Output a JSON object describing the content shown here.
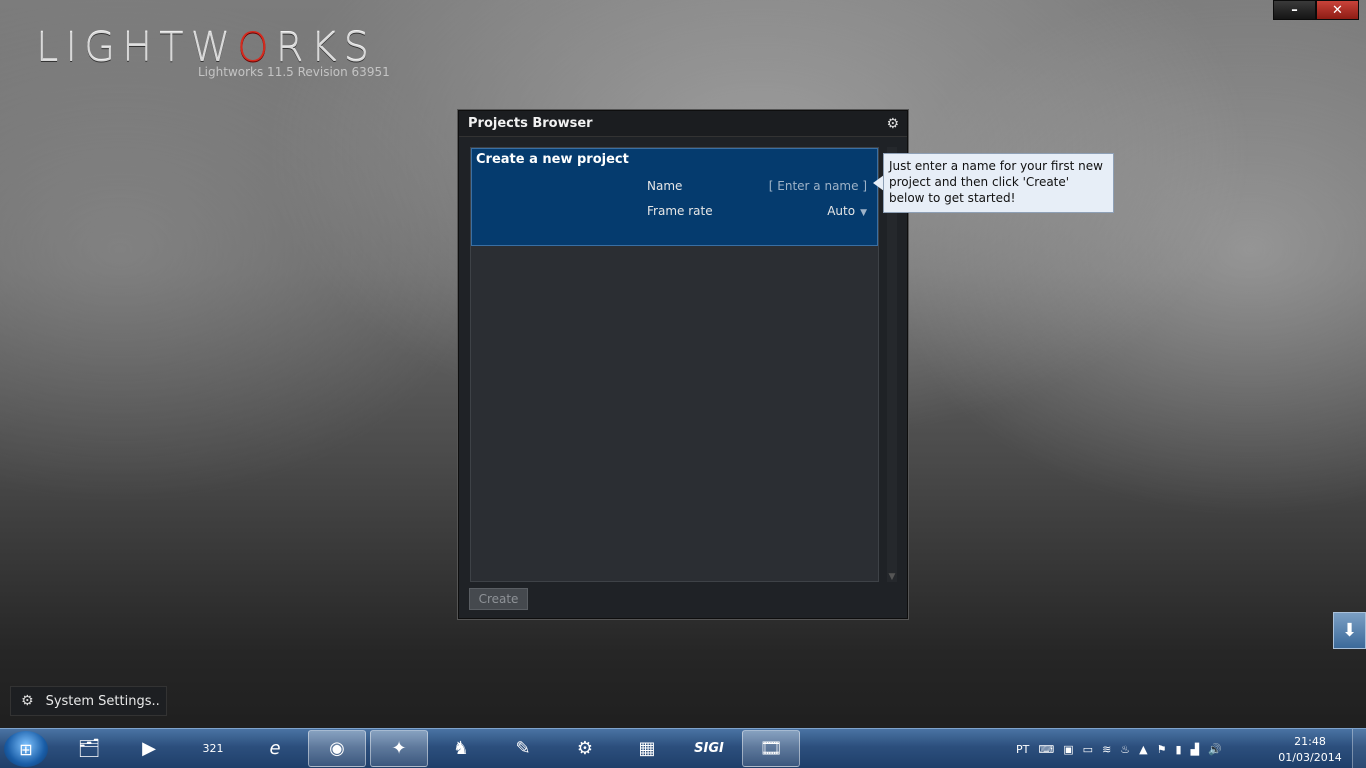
{
  "window_controls": {
    "minimize": "–",
    "close": "✕"
  },
  "logo": {
    "word_pre": "LIGHTW",
    "word_o": "O",
    "word_post": "RKS",
    "revision": "Lightworks 11.5 Revision 63951"
  },
  "projects_browser": {
    "title": "Projects Browser",
    "new_project": {
      "header": "Create a new project",
      "name_label": "Name",
      "name_placeholder": "[ Enter a name ]",
      "frame_rate_label": "Frame rate",
      "frame_rate_value": "Auto"
    },
    "create_button": "Create"
  },
  "tooltip": {
    "text": "Just enter a name for your first new project and then click 'Create' below to get started!"
  },
  "system_settings": {
    "label": "System Settings.."
  },
  "taskbar": {
    "apps": [
      {
        "name": "windows-explorer",
        "glyph": "🗂"
      },
      {
        "name": "media-player",
        "glyph": "▶"
      },
      {
        "name": "media-player-classic",
        "glyph": "321"
      },
      {
        "name": "internet-explorer",
        "glyph": "e"
      },
      {
        "name": "chrome",
        "glyph": "◉"
      },
      {
        "name": "app-5",
        "glyph": "✦"
      },
      {
        "name": "app-6",
        "glyph": "♞"
      },
      {
        "name": "app-7",
        "glyph": "✎"
      },
      {
        "name": "app-8",
        "glyph": "⚙"
      },
      {
        "name": "calculator",
        "glyph": "▦"
      },
      {
        "name": "sigi",
        "glyph": "SIGI"
      },
      {
        "name": "lightworks",
        "glyph": "🎞"
      }
    ],
    "tray_lang": "PT",
    "time": "21:48",
    "date": "01/03/2014"
  }
}
